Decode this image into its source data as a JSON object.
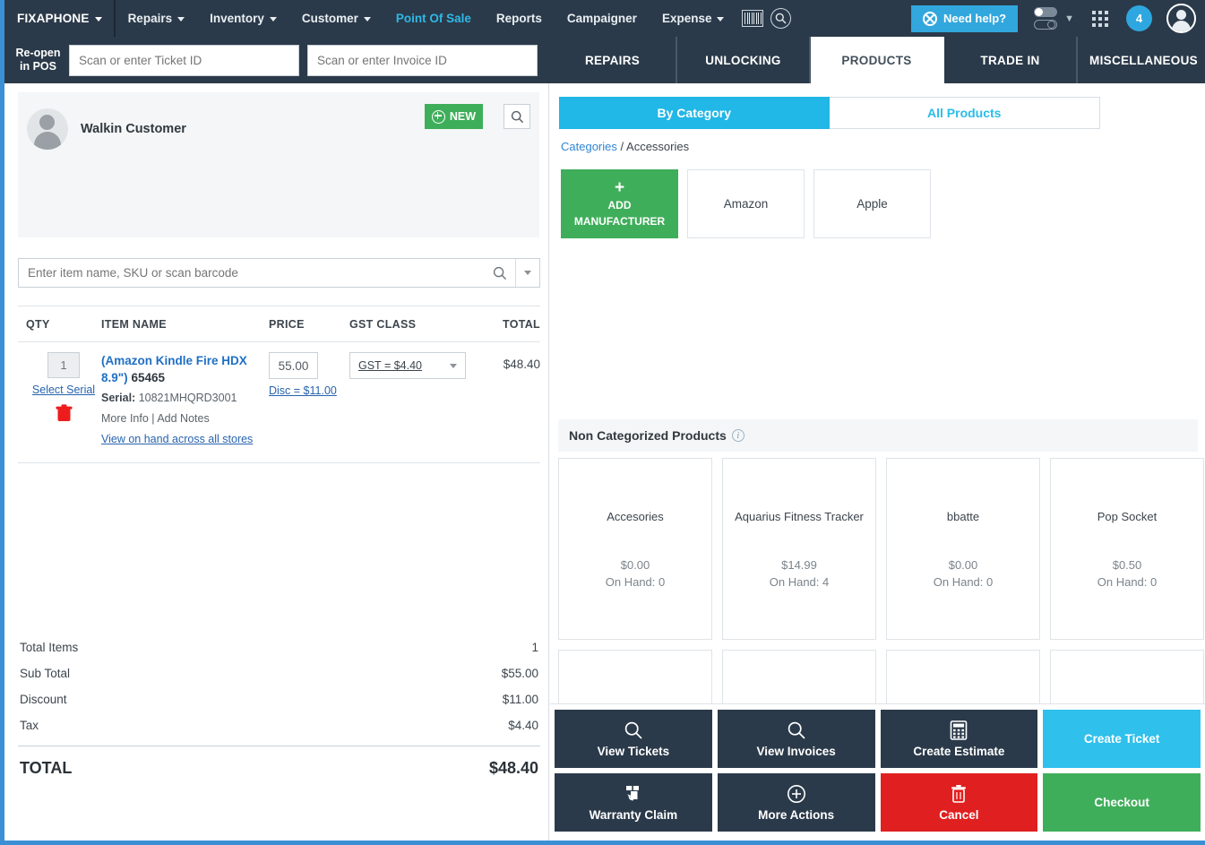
{
  "topnav": {
    "brand": "FIXAPHONE",
    "items": [
      {
        "label": "Repairs",
        "caret": true,
        "active": false
      },
      {
        "label": "Inventory",
        "caret": true,
        "active": false
      },
      {
        "label": "Customer",
        "caret": true,
        "active": false
      },
      {
        "label": "Point Of Sale",
        "caret": false,
        "active": true
      },
      {
        "label": "Reports",
        "caret": false,
        "active": false
      },
      {
        "label": "Campaigner",
        "caret": false,
        "active": false
      },
      {
        "label": "Expense",
        "caret": true,
        "active": false
      }
    ],
    "barcode_icon": "barcode-icon",
    "search_icon": "search-icon",
    "need_help": "Need help?",
    "need_help_icon": "lifebuoy-icon",
    "toggle_icon": "toggle-switch-icon",
    "apps_icon": "apps-grid-icon",
    "notification_count": "4",
    "avatar_icon": "user-avatar-icon",
    "accent": "#2fb8e6",
    "bg": "#2b3a4a"
  },
  "reopen": {
    "label_line1": "Re-open",
    "label_line2": "in POS",
    "ticket_placeholder": "Scan or enter Ticket ID",
    "ticket_value": "",
    "invoice_placeholder": "Scan or enter Invoice ID",
    "invoice_value": ""
  },
  "tabs": [
    {
      "label": "REPAIRS",
      "active": false
    },
    {
      "label": "UNLOCKING",
      "active": false
    },
    {
      "label": "PRODUCTS",
      "active": true
    },
    {
      "label": "TRADE IN",
      "active": false
    },
    {
      "label": "MISCELLANEOUS",
      "active": false
    }
  ],
  "customer": {
    "name": "Walkin Customer",
    "new_label": "NEW",
    "search_icon": "search-icon",
    "avatar_icon": "user-avatar-icon"
  },
  "item_search": {
    "placeholder": "Enter item name, SKU or scan barcode",
    "value": "",
    "search_icon": "search-icon",
    "dropdown_icon": "chevron-down-icon"
  },
  "items_table": {
    "headers": [
      "QTY",
      "ITEM NAME",
      "PRICE",
      "GST CLASS",
      "TOTAL"
    ],
    "rows": [
      {
        "qty": "1",
        "select_serial": "Select Serial",
        "delete_icon": "trash-icon",
        "name": "(Amazon Kindle Fire HDX 8.9\")",
        "sku": "65465",
        "serial_label": "Serial:",
        "serial_value": "10821MHQRD3001",
        "more_info": "More Info",
        "separator": "|",
        "add_notes": "Add Notes",
        "view_on_hand": "View on hand across all stores",
        "price": "55.00",
        "discount": "Disc = $11.00",
        "gst_class": "GST = $4.40",
        "total": "$48.40"
      }
    ]
  },
  "totals": {
    "lines": [
      {
        "label": "Total Items",
        "value": "1"
      },
      {
        "label": "Sub Total",
        "value": "$55.00"
      },
      {
        "label": "Discount",
        "value": "$11.00"
      },
      {
        "label": "Tax",
        "value": "$4.40"
      }
    ],
    "grand_label": "TOTAL",
    "grand_value": "$48.40"
  },
  "products": {
    "mode_tabs": [
      {
        "label": "By Category",
        "active": true
      },
      {
        "label": "All Products",
        "active": false
      }
    ],
    "breadcrumb_root": "Categories",
    "breadcrumb_sep": "/",
    "breadcrumb_current": "Accessories",
    "add_manufacturer_line1": "ADD",
    "add_manufacturer_line2": "MANUFACTURER",
    "add_manufacturer_icon": "plus-icon",
    "manufacturers": [
      {
        "name": "Amazon"
      },
      {
        "name": "Apple"
      }
    ],
    "noncat_title": "Non Categorized Products",
    "noncat_info_icon": "info-icon",
    "cards": [
      {
        "name": "Accesories",
        "price": "$0.00",
        "on_hand": "On Hand: 0"
      },
      {
        "name": "Aquarius Fitness Tracker",
        "price": "$14.99",
        "on_hand": "On Hand: 4"
      },
      {
        "name": "bbatte",
        "price": "$0.00",
        "on_hand": "On Hand: 0"
      },
      {
        "name": "Pop Socket",
        "price": "$0.50",
        "on_hand": "On Hand: 0"
      },
      {
        "name": "",
        "price": "",
        "on_hand": ""
      },
      {
        "name": "",
        "price": "",
        "on_hand": ""
      },
      {
        "name": "",
        "price": "",
        "on_hand": ""
      },
      {
        "name": "",
        "price": "",
        "on_hand": ""
      }
    ]
  },
  "actions": [
    {
      "label": "View Tickets",
      "icon": "search-icon",
      "style": "dark"
    },
    {
      "label": "View Invoices",
      "icon": "search-icon",
      "style": "dark"
    },
    {
      "label": "Create Estimate",
      "icon": "calculator-icon",
      "style": "dark"
    },
    {
      "label": "Create Ticket",
      "icon": "none",
      "style": "cyan"
    },
    {
      "label": "Warranty Claim",
      "icon": "warranty-return-icon",
      "style": "dark"
    },
    {
      "label": "More Actions",
      "icon": "plus-circle-icon",
      "style": "dark"
    },
    {
      "label": "Cancel",
      "icon": "trash-icon",
      "style": "red"
    },
    {
      "label": "Checkout",
      "icon": "none",
      "style": "green"
    }
  ],
  "colors": {
    "nav_bg": "#2b3a4a",
    "accent_cyan": "#29bde8",
    "green": "#3fae5a",
    "red": "#e02020",
    "frame_blue": "#3b8fd4"
  }
}
